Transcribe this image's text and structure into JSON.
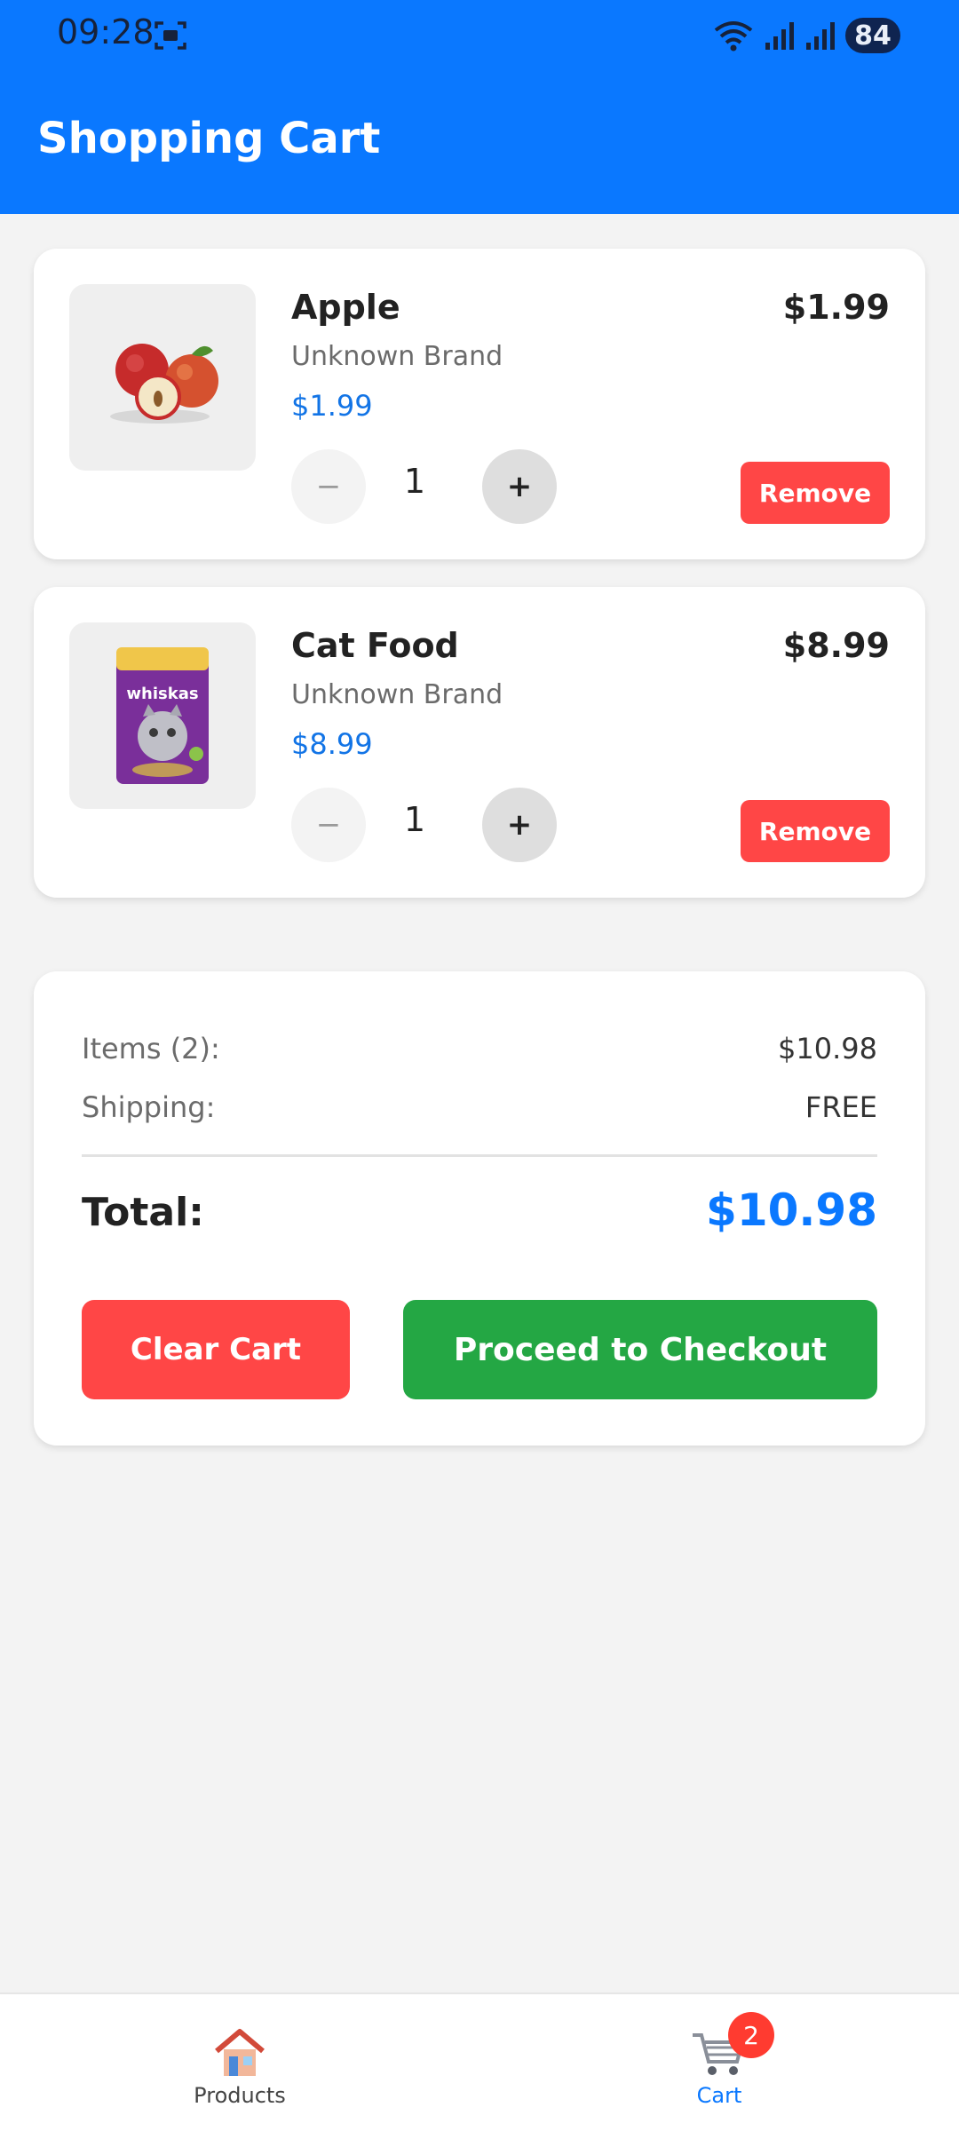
{
  "status_bar": {
    "time": "09:28",
    "battery": "84"
  },
  "header": {
    "title": "Shopping Cart"
  },
  "cart_items": [
    {
      "name": "Apple",
      "brand": "Unknown Brand",
      "unit_price": "$1.99",
      "line_total": "$1.99",
      "quantity": "1",
      "remove_label": "Remove",
      "minus_label": "−",
      "plus_label": "+"
    },
    {
      "name": "Cat Food",
      "brand": "Unknown Brand",
      "unit_price": "$8.99",
      "line_total": "$8.99",
      "quantity": "1",
      "remove_label": "Remove",
      "minus_label": "−",
      "plus_label": "+",
      "image_text": "whiskas"
    }
  ],
  "summary": {
    "items_label": "Items (2):",
    "items_value": "$10.98",
    "shipping_label": "Shipping:",
    "shipping_value": "FREE",
    "total_label": "Total:",
    "total_value": "$10.98",
    "clear_label": "Clear Cart",
    "checkout_label": "Proceed to Checkout"
  },
  "bottom_nav": {
    "products_label": "Products",
    "cart_label": "Cart",
    "cart_badge": "2"
  },
  "colors": {
    "primary": "#0a78ff",
    "danger": "#ff4646",
    "success": "#24a744",
    "price": "#1274e6"
  }
}
